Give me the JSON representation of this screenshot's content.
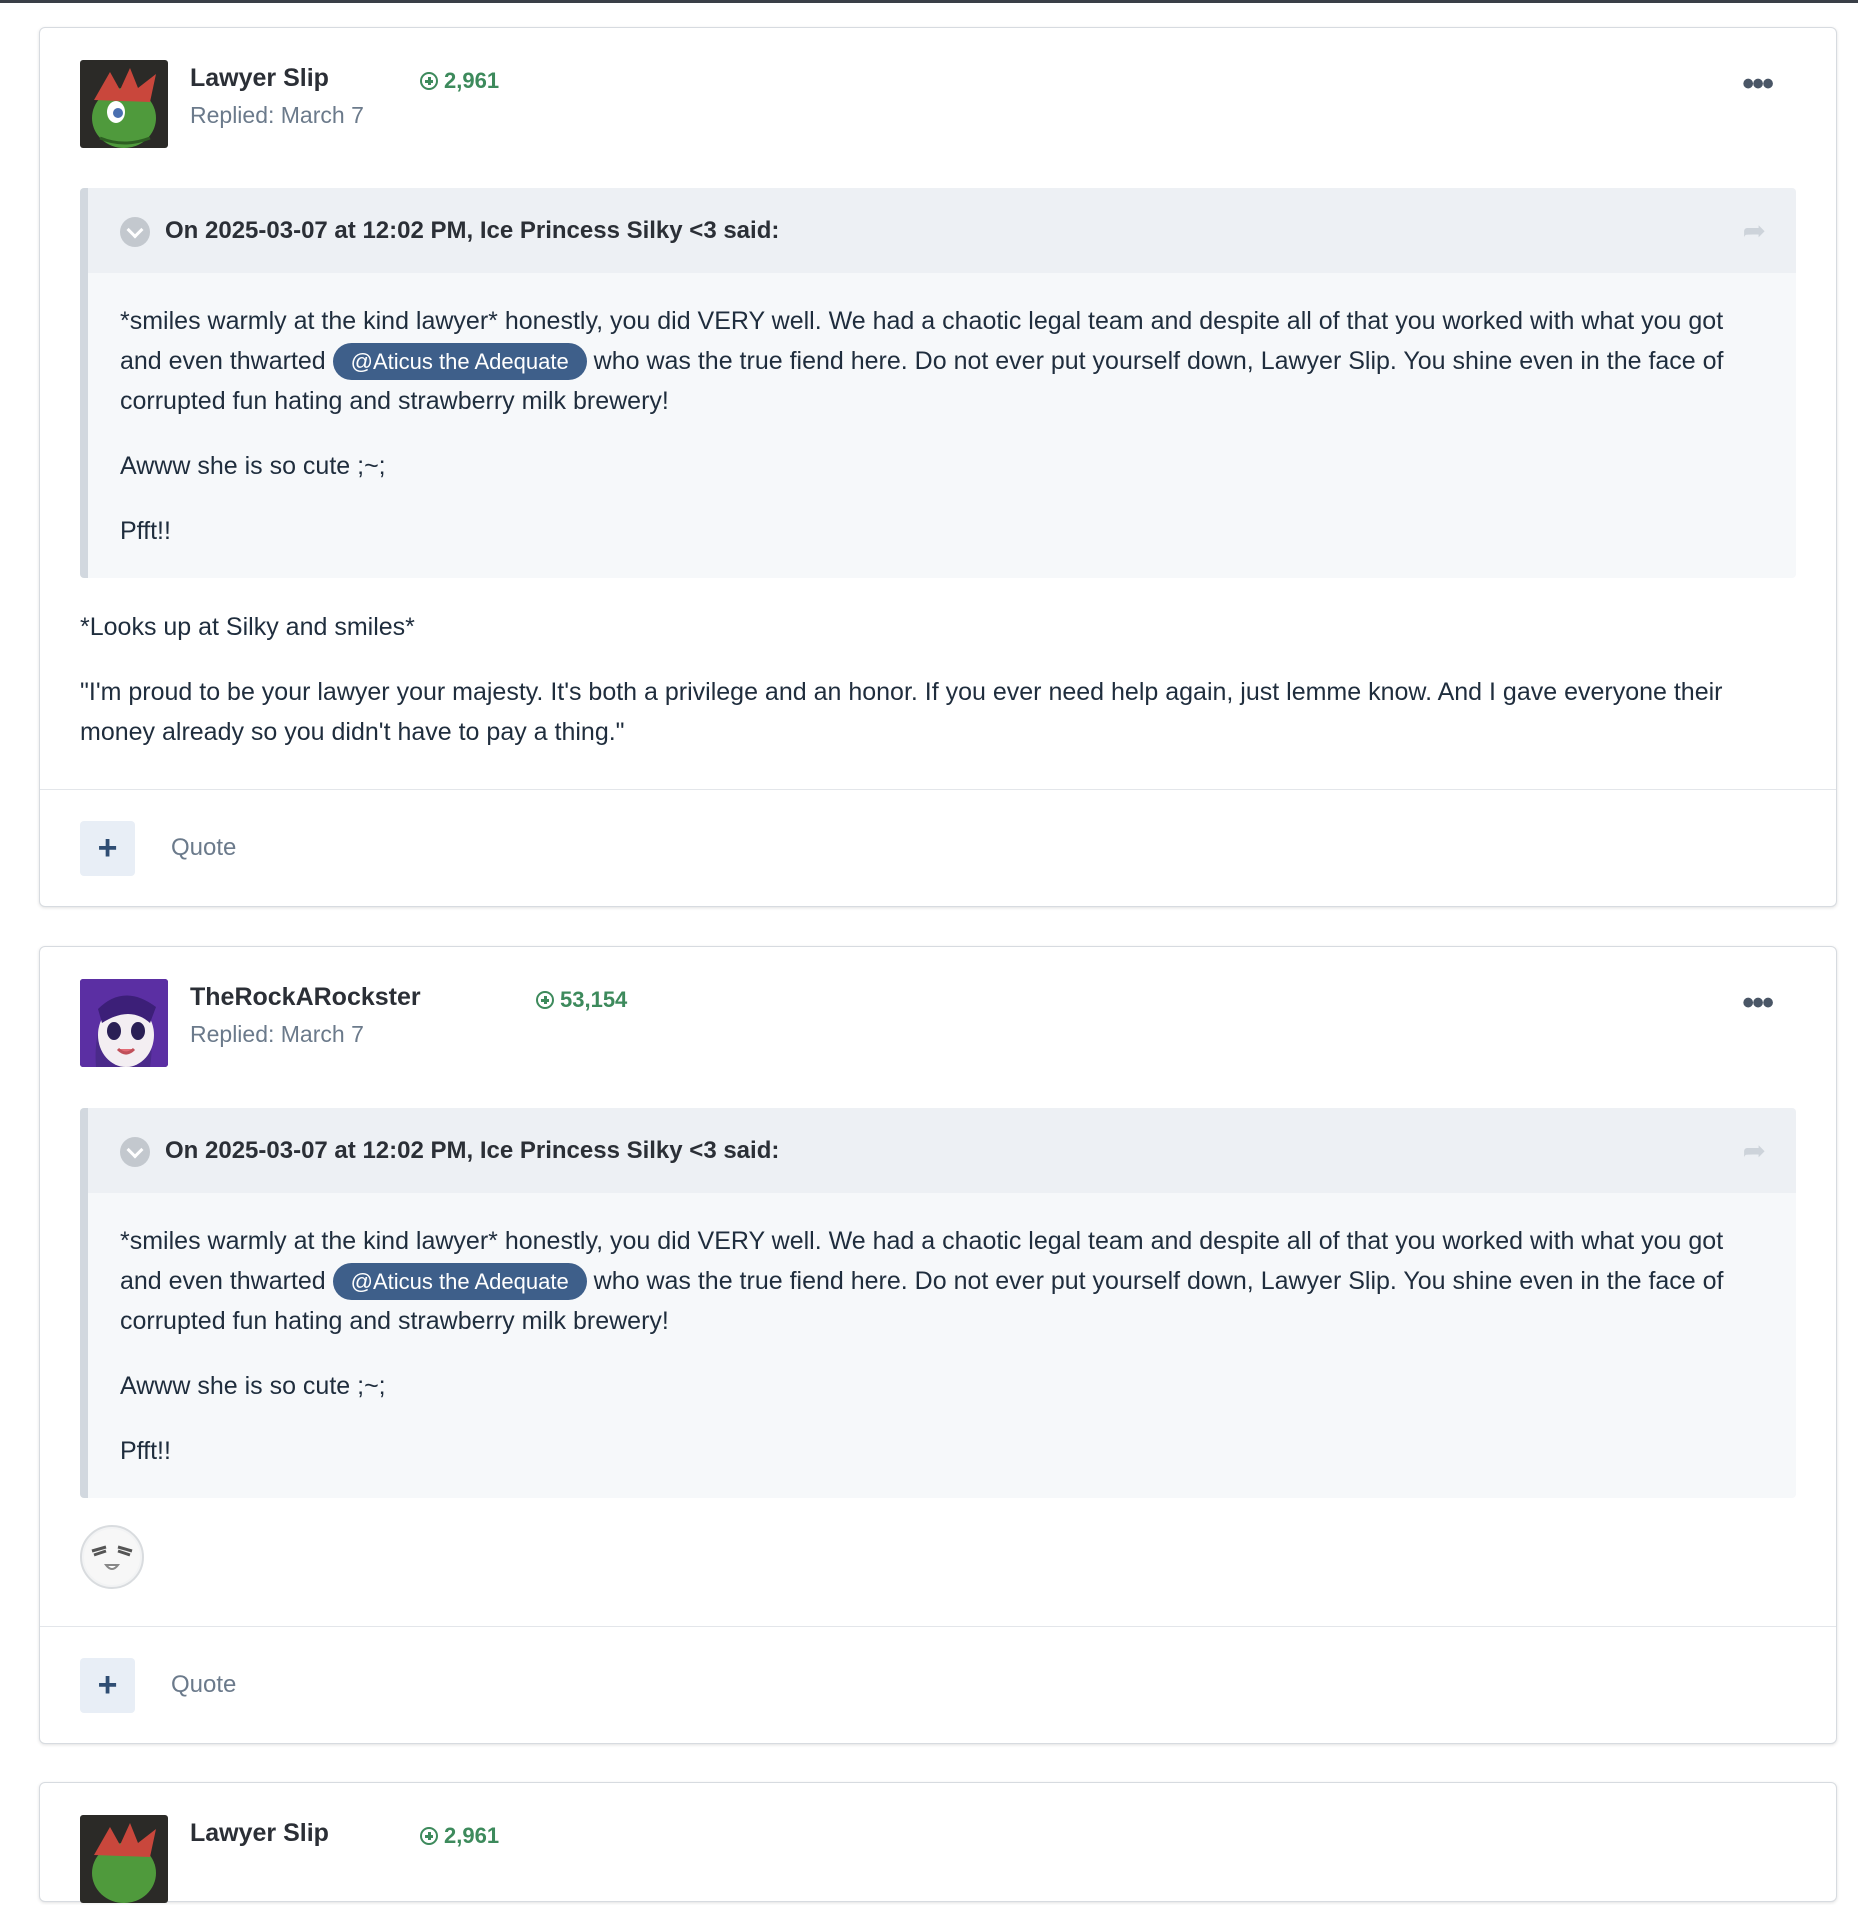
{
  "posts": [
    {
      "author": "Lawyer Slip",
      "reputation": "2,961",
      "replied": "Replied: March 7",
      "quote": {
        "citation": "On 2025-03-07 at 12:02 PM, Ice Princess Silky <3 said:",
        "p1_before": "*smiles warmly at the kind lawyer* honestly, you did VERY well. We had a chaotic legal team and despite all of that you worked with what you got and even thwarted ",
        "mention": "@Aticus the Adequate",
        "p1_after": " who was the true fiend here. Do not ever put yourself down, Lawyer Slip. You shine even in the face of corrupted fun hating and strawberry milk brewery!",
        "p2": "Awww she is so cute ;~;",
        "p3": "Pfft!!"
      },
      "body": [
        "*Looks up at Silky and smiles*",
        "\"I'm proud to be your lawyer your majesty. It's both a privilege and an honor. If you ever need help again, just lemme know. And I gave everyone their money already so you didn't have to pay a thing.\""
      ],
      "quote_label": "Quote"
    },
    {
      "author": "TheRockARockster",
      "reputation": "53,154",
      "replied": "Replied: March 7",
      "quote": {
        "citation": "On 2025-03-07 at 12:02 PM, Ice Princess Silky <3 said:",
        "p1_before": "*smiles warmly at the kind lawyer* honestly, you did VERY well. We had a chaotic legal team and despite all of that you worked with what you got and even thwarted ",
        "mention": "@Aticus the Adequate",
        "p1_after": " who was the true fiend here. Do not ever put yourself down, Lawyer Slip. You shine even in the face of corrupted fun hating and strawberry milk brewery!",
        "p2": "Awww she is so cute ;~;",
        "p3": "Pfft!!"
      },
      "quote_label": "Quote"
    },
    {
      "author": "Lawyer Slip",
      "reputation": "2,961"
    }
  ],
  "icons": {
    "menu": "ellipsis-icon",
    "toggle": "chevron-down-icon",
    "share": "share-arrow-icon",
    "reputation": "plus-circle-icon",
    "add": "plus-icon"
  },
  "colors": {
    "reputation": "#3d8a5c",
    "mention_bg": "#3e5f8a",
    "quote_bg": "#f6f8fa",
    "quote_head_bg": "#edf0f4"
  }
}
